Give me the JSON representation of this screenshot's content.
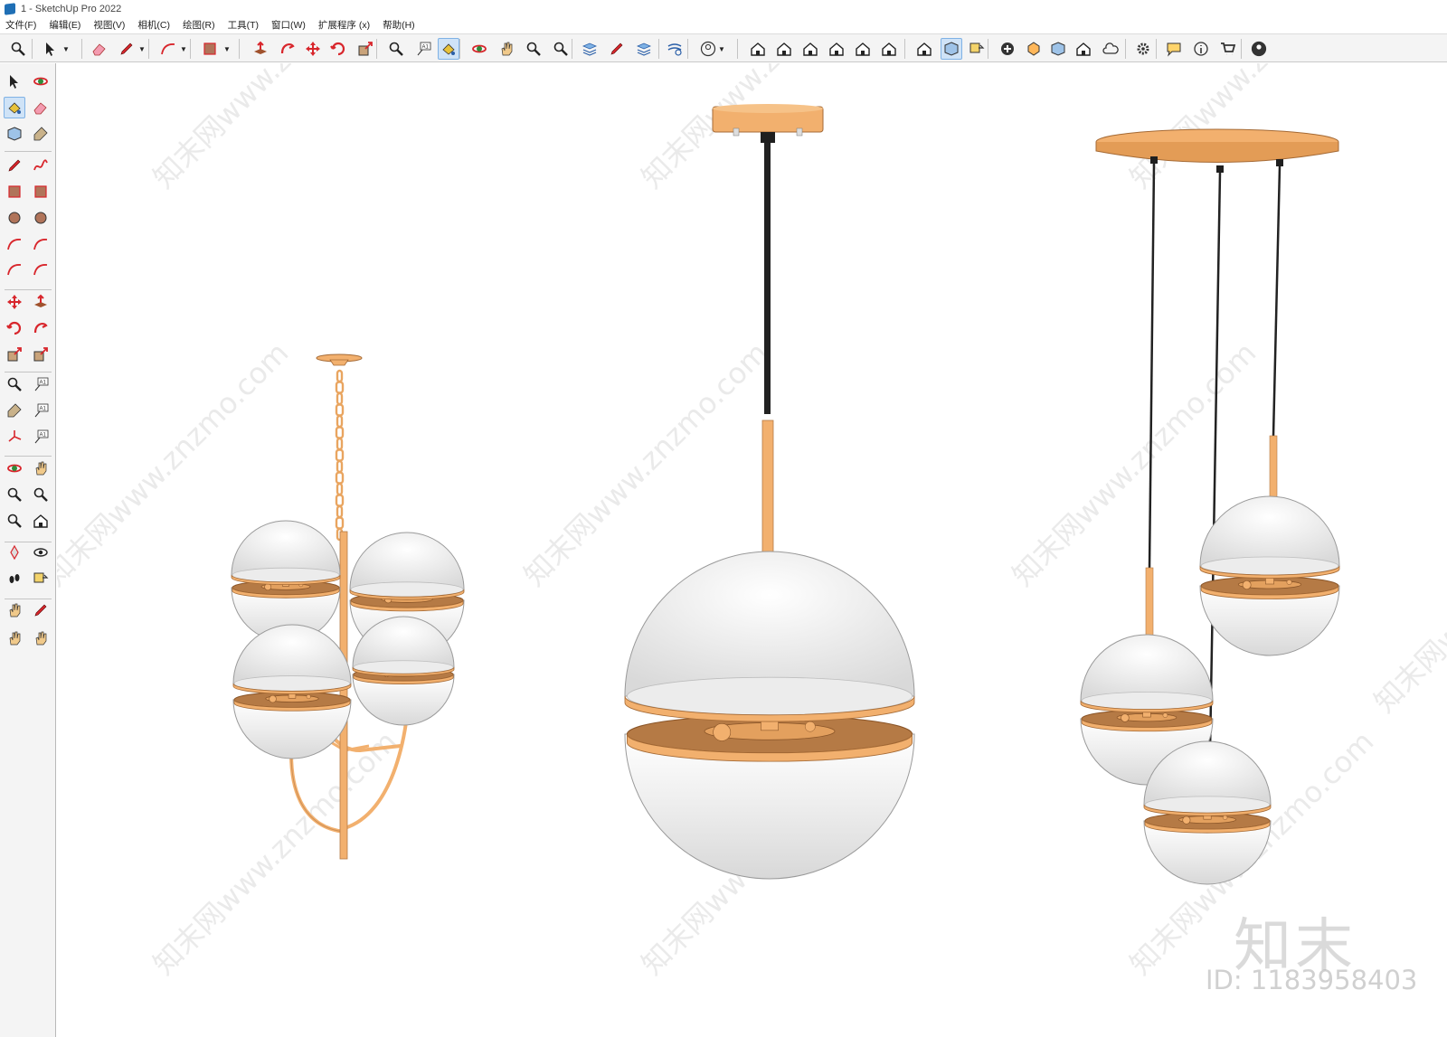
{
  "window": {
    "title": "1 - SketchUp Pro 2022"
  },
  "menubar": [
    "文件(F)",
    "编辑(E)",
    "视图(V)",
    "相机(C)",
    "绘图(R)",
    "工具(T)",
    "窗口(W)",
    "扩展程序 (x)",
    "帮助(H)"
  ],
  "toolbar_icons": [
    "zoom-icon",
    "select-icon",
    "eraser-icon",
    "pencil-icon",
    "arc-icon",
    "rectangle-icon",
    "push-pull-icon",
    "follow-me-icon",
    "move-icon",
    "rotate-icon",
    "scale-icon",
    "tape-measure-icon",
    "text-icon",
    "paint-bucket-icon",
    "orbit-icon",
    "pan-icon",
    "zoom-window-icon",
    "zoom-extents-icon",
    "layers-icon",
    "outliner-icon",
    "styles-icon",
    "shadows-icon",
    "account-icon",
    "iso-view-icon",
    "top-view-icon",
    "front-view-icon",
    "right-view-icon",
    "back-view-icon",
    "left-view-icon",
    "warehouse-icon",
    "component-icon",
    "section-icon",
    "add-location-icon",
    "sandbox-icon",
    "dynamic-components-icon",
    "extension-warehouse-icon",
    "cloud-icon",
    "settings-icon",
    "message-icon",
    "info-icon",
    "cart-icon",
    "profile-icon"
  ],
  "left_toolbar_icons": [
    "select-icon",
    "orbit-icon",
    "paint-bucket-icon",
    "eraser-icon",
    "component-icon",
    "tag-icon",
    "line-icon",
    "freehand-icon",
    "rectangle-icon",
    "rotated-rectangle-icon",
    "circle-icon",
    "polygon-icon",
    "arc-icon",
    "two-point-arc-icon",
    "three-point-arc-icon",
    "pie-icon",
    "move-icon",
    "push-pull-icon",
    "rotate-icon",
    "follow-me-icon",
    "scale-icon",
    "offset-icon",
    "tape-measure-icon",
    "dimension-icon",
    "protractor-icon",
    "text-icon",
    "axes-icon",
    "3d-text-icon",
    "orbit-tool-icon",
    "pan-tool-icon",
    "zoom-tool-icon",
    "zoom-window-tool-icon",
    "zoom-extents-tool-icon",
    "previous-view-icon",
    "position-camera-icon",
    "look-around-icon",
    "walk-icon",
    "section-plane-icon",
    "layers-panel-icon",
    "outliner-panel-icon",
    "styles-panel-icon",
    "shadows-panel-icon"
  ],
  "colors": {
    "brass": "#f2b06e",
    "brass_dark": "#b57a45",
    "glass": "#f3f3f3",
    "cord": "#1f1f1f",
    "accent": "#cfe3f7"
  },
  "watermark": {
    "site": "知末网www.znzmo.com",
    "logo": "知末",
    "id": "ID: 1183958403"
  }
}
